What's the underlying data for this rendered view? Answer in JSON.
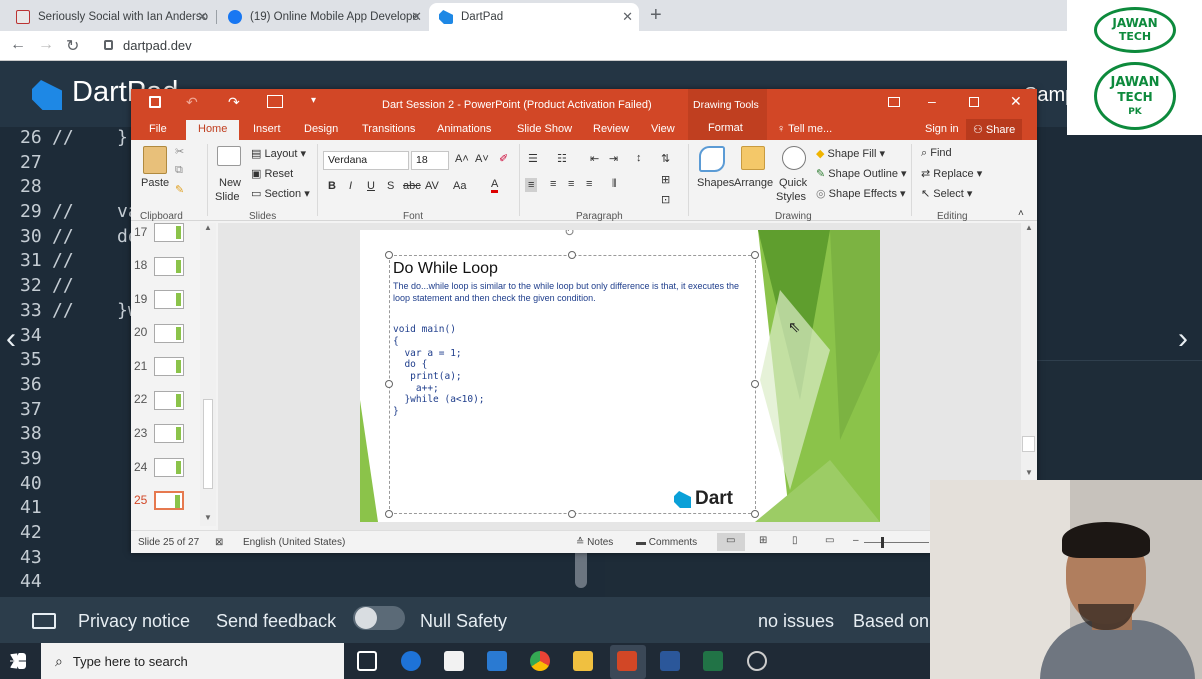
{
  "browser": {
    "tabs": [
      {
        "title": "Seriously Social with Ian Anderso"
      },
      {
        "title": "(19) Online Mobile App Develope"
      },
      {
        "title": "DartPad"
      }
    ],
    "url": "dartpad.dev"
  },
  "dartpad": {
    "title": "DartPad",
    "header_right": "Samp",
    "line_numbers": [
      "26",
      "27",
      "28",
      "29",
      "30",
      "31",
      "32",
      "33",
      "34",
      "35",
      "36",
      "37",
      "38",
      "39",
      "40",
      "41",
      "42",
      "43",
      "44"
    ],
    "code": {
      "l26": "//    }",
      "l29": "//    va",
      "l30": "//    do",
      "l31": "//",
      "l32": "//",
      "l33": "//    }w"
    },
    "footer": {
      "privacy": "Privacy notice",
      "feedback": "Send feedback",
      "null_safety": "Null Safety",
      "issues": "no issues",
      "based_on": "Based on"
    }
  },
  "powerpoint": {
    "title": "Dart Session 2 - PowerPoint (Product Activation Failed)",
    "drawing_tools": "Drawing Tools",
    "tabs": [
      "File",
      "Home",
      "Insert",
      "Design",
      "Transitions",
      "Animations",
      "Slide Show",
      "Review",
      "View",
      "Format"
    ],
    "tell_me": "Tell me...",
    "sign_in": "Sign in",
    "share": "Share",
    "ribbon": {
      "paste": "Paste",
      "new_slide": "New",
      "new_slide2": "Slide",
      "layout": "Layout",
      "reset": "Reset",
      "section": "Section",
      "font_name": "Verdana",
      "font_size": "18",
      "shapes": "Shapes",
      "arrange": "Arrange",
      "quick": "Quick",
      "styles": "Styles",
      "shape_fill": "Shape Fill",
      "shape_outline": "Shape Outline",
      "shape_effects": "Shape Effects",
      "find": "Find",
      "replace": "Replace",
      "select": "Select",
      "groups": [
        "Clipboard",
        "Slides",
        "Font",
        "Paragraph",
        "Drawing",
        "Editing"
      ]
    },
    "thumbnails": [
      "17",
      "18",
      "19",
      "20",
      "21",
      "22",
      "23",
      "24",
      "25"
    ],
    "slide": {
      "heading": "Do While Loop",
      "description": "The do...while loop is similar to the while loop but only difference is that, it executes the loop statement and then check the given condition.",
      "code_lines": [
        "void main()",
        "{",
        "  var a = 1;",
        "  do {",
        "   print(a);",
        "    a++;",
        "  }while (a<10);",
        "}"
      ],
      "logo_text": "Dart"
    },
    "status": {
      "slide_count": "Slide 25 of 27",
      "language": "English (United States)",
      "notes": "Notes",
      "comments": "Comments"
    }
  },
  "watermark": {
    "line1": "JAWAN",
    "line2": "TECH",
    "line3": "PK"
  },
  "taskbar": {
    "search_placeholder": "Type here to search"
  },
  "colors": {
    "ppt_accent": "#d24726",
    "dart_bg": "#1d2b38",
    "slide_green": "#8bc34a"
  }
}
